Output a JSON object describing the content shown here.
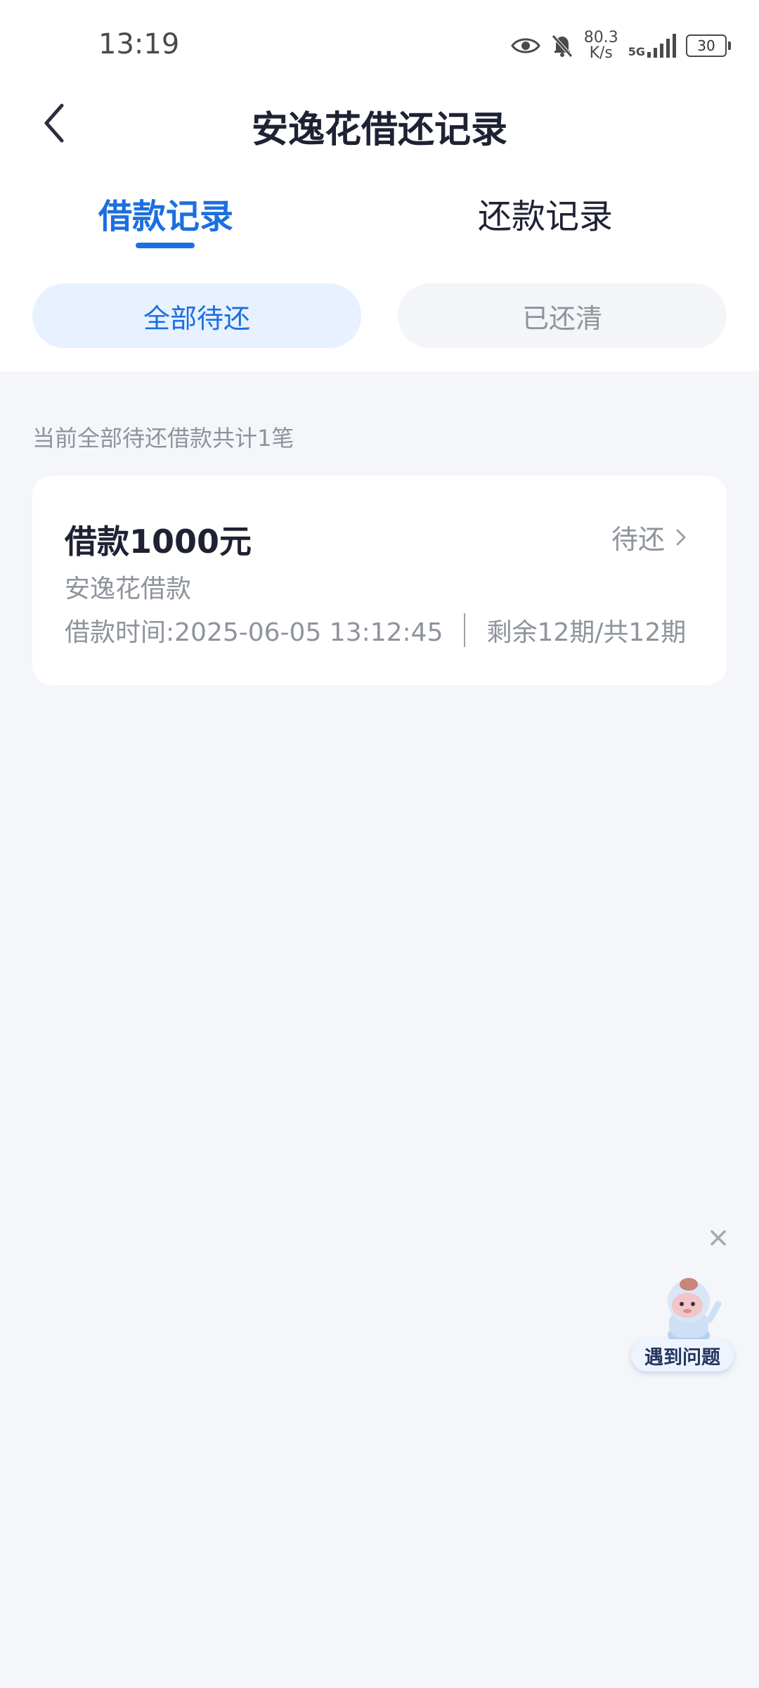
{
  "status_bar": {
    "time": "13:19",
    "net_speed_value": "80.3",
    "net_speed_unit": "K/s",
    "signal_label": "5G",
    "battery": "30",
    "icons": [
      "eye-icon",
      "bell-off-icon",
      "signal-icon",
      "battery-icon"
    ]
  },
  "header": {
    "title": "安逸花借还记录",
    "back_icon": "chevron-left-icon"
  },
  "tabs": [
    {
      "label": "借款记录",
      "active": true
    },
    {
      "label": "还款记录",
      "active": false
    }
  ],
  "filters": [
    {
      "label": "全部待还",
      "active": true
    },
    {
      "label": "已还清",
      "active": false
    }
  ],
  "summary": "当前全部待还借款共计1笔",
  "loans": [
    {
      "amount_title": "借款1000元",
      "status": "待还",
      "product": "安逸花借款",
      "time": "借款时间:2025-06-05 13:12:45",
      "periods": "剩余12期/共12期"
    }
  ],
  "floating_help": {
    "label": "遇到问题",
    "close_icon": "close-icon",
    "mascot_icon": "mascot-icon"
  },
  "colors": {
    "accent": "#1b6fe0",
    "page_bg": "#f4f6f9",
    "pill_active_bg": "#e7f1ff",
    "pill_inactive_bg": "#f3f5f8",
    "secondary_text": "#8e939c"
  }
}
